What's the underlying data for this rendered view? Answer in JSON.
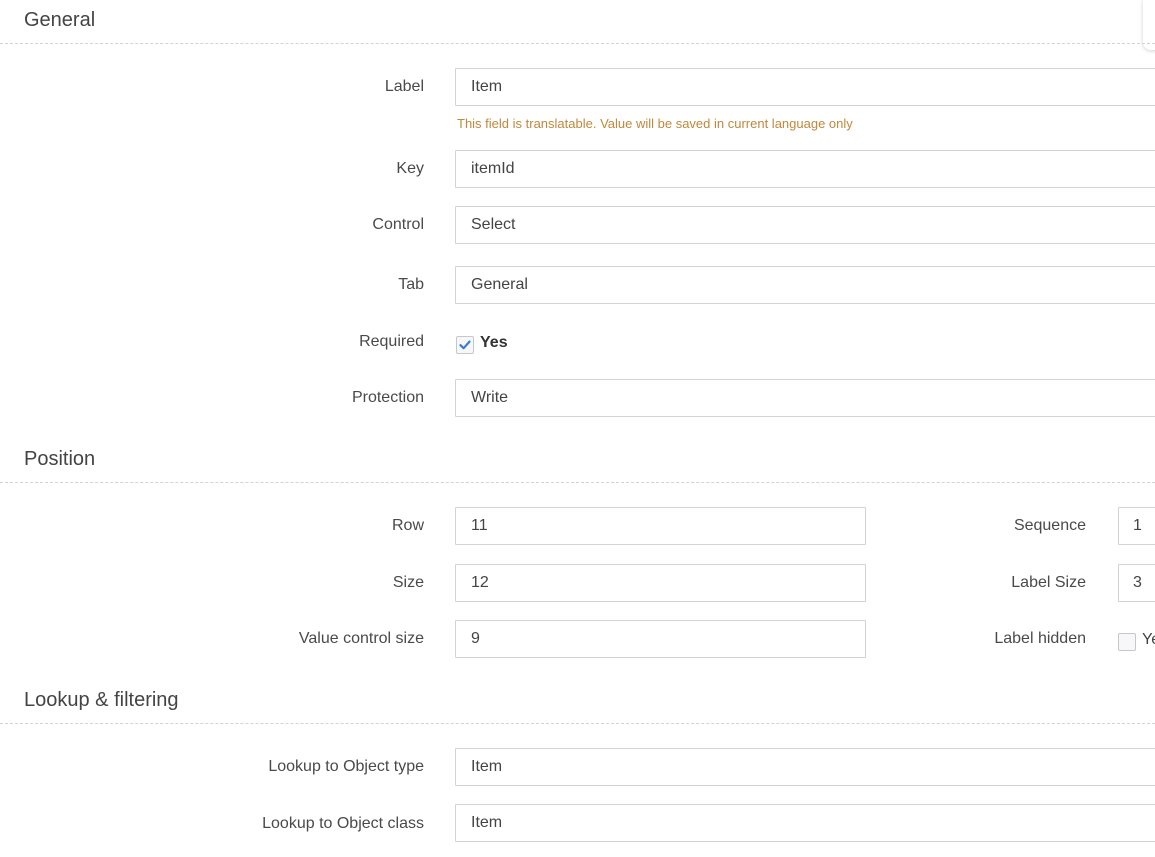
{
  "sections": {
    "general": {
      "title": "General",
      "label": {
        "caption": "Label",
        "value": "Item",
        "hint": "This field is translatable. Value will be saved in current language only"
      },
      "key": {
        "caption": "Key",
        "value": "itemId"
      },
      "control": {
        "caption": "Control",
        "value": "Select"
      },
      "tab": {
        "caption": "Tab",
        "value": "General"
      },
      "required": {
        "caption": "Required",
        "checked": true,
        "option_label": "Yes"
      },
      "protection": {
        "caption": "Protection",
        "value": "Write"
      }
    },
    "position": {
      "title": "Position",
      "row": {
        "caption": "Row",
        "value": "11"
      },
      "size": {
        "caption": "Size",
        "value": "12"
      },
      "value_control_size": {
        "caption": "Value control size",
        "value": "9"
      },
      "sequence": {
        "caption": "Sequence",
        "value": "1"
      },
      "label_size": {
        "caption": "Label Size",
        "value": "3"
      },
      "label_hidden": {
        "caption": "Label hidden",
        "checked": false,
        "option_label": "Yes"
      }
    },
    "lookup": {
      "title": "Lookup & filtering",
      "object_type": {
        "caption": "Lookup to Object type",
        "value": "Item"
      },
      "object_class": {
        "caption": "Lookup to Object class",
        "value": "Item"
      }
    }
  },
  "colors": {
    "hint": "#c0883c",
    "check_accent": "#3a7bd5",
    "border": "#cfd4da"
  }
}
